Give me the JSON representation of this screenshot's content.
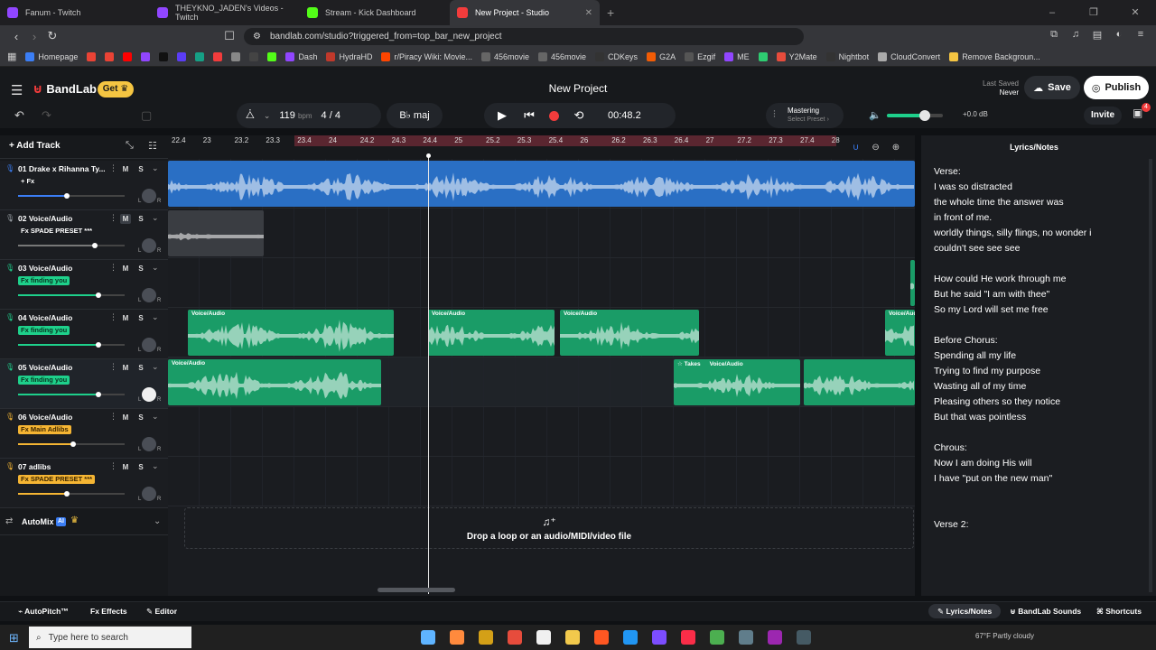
{
  "browser": {
    "tabs": [
      {
        "label": "Fanum - Twitch",
        "color": "#9146ff"
      },
      {
        "label": "THEYKNO_JADEN's Videos - Twitch",
        "color": "#9146ff"
      },
      {
        "label": "Stream - Kick Dashboard",
        "color": "#53fc18"
      },
      {
        "label": "New Project - Studio",
        "color": "#f23c3c"
      }
    ],
    "new_tab": "+",
    "url": "bandlab.com/studio?triggered_from=top_bar_new_project",
    "bookmarks": [
      {
        "label": "Homepage",
        "color": "#3b7ef5"
      },
      {
        "label": "",
        "color": "#ea4335"
      },
      {
        "label": "",
        "color": "#ea4335"
      },
      {
        "label": "",
        "color": "#ff0000"
      },
      {
        "label": "",
        "color": "#9146ff"
      },
      {
        "label": "",
        "color": "#111111"
      },
      {
        "label": "",
        "color": "#5b3df5"
      },
      {
        "label": "",
        "color": "#16a085"
      },
      {
        "label": "",
        "color": "#f23c3c"
      },
      {
        "label": "",
        "color": "#888888"
      },
      {
        "label": "",
        "color": "#444444"
      },
      {
        "label": "",
        "color": "#53fc18"
      },
      {
        "label": "Dash",
        "color": "#9146ff"
      },
      {
        "label": "HydraHD",
        "color": "#c0392b"
      },
      {
        "label": "r/Piracy Wiki: Movie...",
        "color": "#ff4500"
      },
      {
        "label": "456movie",
        "color": "#666666"
      },
      {
        "label": "456movie",
        "color": "#666666"
      },
      {
        "label": "CDKeys",
        "color": "#333333"
      },
      {
        "label": "G2A",
        "color": "#f25c05"
      },
      {
        "label": "Ezgif",
        "color": "#555555"
      },
      {
        "label": "ME",
        "color": "#9146ff"
      },
      {
        "label": "",
        "color": "#2ecc71"
      },
      {
        "label": "Y2Mate",
        "color": "#e74c3c"
      },
      {
        "label": "Nightbot",
        "color": "#333333"
      },
      {
        "label": "CloudConvert",
        "color": "#aaaaaa"
      },
      {
        "label": "Remove Backgroun...",
        "color": "#f5c542"
      }
    ]
  },
  "header": {
    "brand": "BandLab",
    "get_label": "Get",
    "project_title": "New Project",
    "last_saved_label": "Last Saved",
    "last_saved_value": "Never",
    "save_label": "Save",
    "publish_label": "Publish"
  },
  "transport": {
    "tempo": "119",
    "tempo_unit": "bpm",
    "time_signature": "4 / 4",
    "key": "B♭ maj",
    "time": "00:48.2",
    "mastering_title": "Mastering",
    "mastering_preset": "Select Preset",
    "volume_db": "+0.0 dB",
    "volume_level": 0.68,
    "invite_label": "Invite",
    "gift_count": "4"
  },
  "add_track_label": "Add Track",
  "ruler_ticks": [
    "22.4",
    "23",
    "23.2",
    "23.3",
    "23.4",
    "24",
    "24.2",
    "24.3",
    "24.4",
    "25",
    "25.2",
    "25.3",
    "25.4",
    "26",
    "26.2",
    "26.3",
    "26.4",
    "27",
    "27.2",
    "27.3",
    "27.4",
    "28"
  ],
  "tracks": [
    {
      "number": "01",
      "name": "Drake x Rihanna Ty...",
      "fx": "+ Fx",
      "fx_style": "plain",
      "mic_color": "#3b7ef5",
      "volume": 0.46,
      "fill": "#3b7ef5",
      "muted": false,
      "pan_white": false
    },
    {
      "number": "02",
      "name": "Voice/Audio",
      "fx": "Fx SPADE PRESET ***",
      "fx_style": "plain",
      "mic_color": "#9aa0a6",
      "volume": 0.72,
      "fill": "#777777",
      "muted": true,
      "pan_white": false
    },
    {
      "number": "03",
      "name": "Voice/Audio",
      "fx": "Fx finding you",
      "fx_style": "green",
      "mic_color": "#1ed08b",
      "volume": 0.75,
      "fill": "#1ed08b",
      "muted": false,
      "pan_white": false
    },
    {
      "number": "04",
      "name": "Voice/Audio",
      "fx": "Fx finding you",
      "fx_style": "green",
      "mic_color": "#1ed08b",
      "volume": 0.75,
      "fill": "#1ed08b",
      "muted": false,
      "pan_white": false
    },
    {
      "number": "05",
      "name": "Voice/Audio",
      "fx": "Fx finding you",
      "fx_style": "green",
      "mic_color": "#1ed08b",
      "volume": 0.75,
      "fill": "#1ed08b",
      "muted": false,
      "pan_white": true
    },
    {
      "number": "06",
      "name": "Voice/Audio",
      "fx": "Fx Main Adlibs",
      "fx_style": "yellow",
      "mic_color": "#f5b533",
      "volume": 0.52,
      "fill": "#f5b533",
      "muted": false,
      "pan_white": false
    },
    {
      "number": "07",
      "name": "adlibs",
      "fx": "Fx SPADE PRESET ***",
      "fx_style": "yellow",
      "mic_color": "#f5b533",
      "volume": 0.46,
      "fill": "#f5b533",
      "muted": false,
      "pan_white": false
    }
  ],
  "track_buttons": {
    "mute": "M",
    "solo": "S",
    "left": "L",
    "right": "R"
  },
  "automix": {
    "label": "AutoMix",
    "badge": "AI"
  },
  "clips": {
    "label": "Voice/Audio",
    "takes_label": "Takes"
  },
  "dropzone_text": "Drop a loop or an audio/MIDI/video file",
  "lyrics": {
    "title": "Lyrics/Notes",
    "text": "Verse:\nI was so distracted\nthe whole time the answer was\nin front of me.\nworldly things, silly flings, no wonder i\ncouldn't see see see\n\nHow could He work through me\nBut he said \"I am with thee\"\nSo my Lord will set me free\n\nBefore Chorus:\nSpending all my life\nTrying to find my purpose\nWasting all of my time\nPleasing others so they notice\nBut that was pointless\n\nChrous:\nNow I am doing His will\nI have \"put on the new man\"\n\n\nVerse 2:"
  },
  "bottom": {
    "autopitch": "AutoPitch™",
    "effects": "Effects",
    "editor": "Editor",
    "lyrics_notes": "Lyrics/Notes",
    "sounds": "BandLab Sounds",
    "shortcuts": "Shortcuts"
  },
  "taskbar": {
    "search_placeholder": "Type here to search",
    "weather": "67°F  Partly cloudy"
  }
}
